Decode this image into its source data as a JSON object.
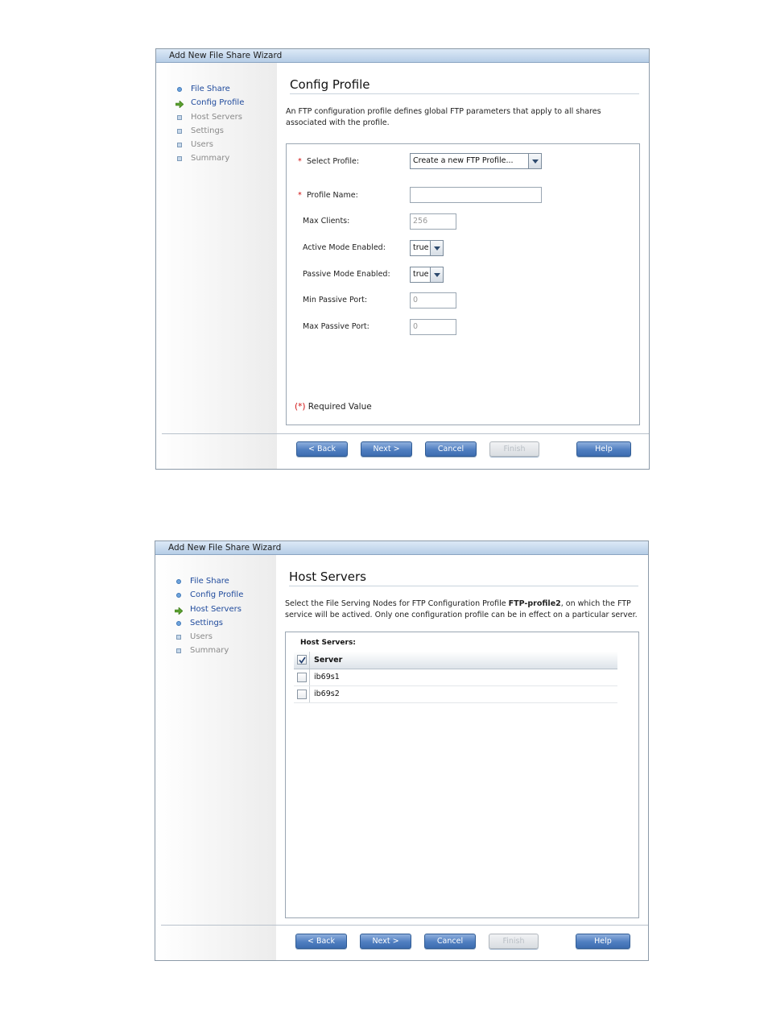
{
  "wizard1": {
    "title": "Add New File Share Wizard",
    "nav": [
      {
        "label": "File Share",
        "state": "done",
        "icon": "dot-icon"
      },
      {
        "label": "Config Profile",
        "state": "current",
        "icon": "arrow-icon"
      },
      {
        "label": "Host Servers",
        "state": "todo",
        "icon": "square-icon"
      },
      {
        "label": "Settings",
        "state": "todo",
        "icon": "square-icon"
      },
      {
        "label": "Users",
        "state": "todo",
        "icon": "square-icon"
      },
      {
        "label": "Summary",
        "state": "todo",
        "icon": "square-icon"
      }
    ],
    "page_title": "Config Profile",
    "description": "An FTP configuration profile defines global FTP parameters that apply to all shares associated with the profile.",
    "form": {
      "select_profile": {
        "label": "Select Profile:",
        "value": "Create a new FTP Profile..."
      },
      "profile_name": {
        "label": "Profile Name:",
        "value": ""
      },
      "max_clients": {
        "label": "Max Clients:",
        "value": "256"
      },
      "active_mode": {
        "label": "Active Mode Enabled:",
        "value": "true"
      },
      "passive_mode": {
        "label": "Passive Mode Enabled:",
        "value": "true"
      },
      "min_passive_port": {
        "label": "Min Passive Port:",
        "value": "0"
      },
      "max_passive_port": {
        "label": "Max Passive Port:",
        "value": "0"
      }
    },
    "required_marker": "(*)",
    "required_text": "Required Value",
    "buttons": {
      "back": "< Back",
      "next": "Next >",
      "cancel": "Cancel",
      "finish": "Finish",
      "help": "Help"
    }
  },
  "wizard2": {
    "title": "Add New File Share Wizard",
    "nav": [
      {
        "label": "File Share",
        "state": "done",
        "icon": "dot-icon"
      },
      {
        "label": "Config Profile",
        "state": "done",
        "icon": "dot-icon"
      },
      {
        "label": "Host Servers",
        "state": "current",
        "icon": "arrow-icon"
      },
      {
        "label": "Settings",
        "state": "done",
        "icon": "dot-icon"
      },
      {
        "label": "Users",
        "state": "todo",
        "icon": "square-icon"
      },
      {
        "label": "Summary",
        "state": "todo",
        "icon": "square-icon"
      }
    ],
    "page_title": "Host Servers",
    "description_pre": "Select the File Serving Nodes for FTP Configuration Profile ",
    "description_profile": "FTP-profile2",
    "description_post": ", on which the FTP service will be actived. Only one configuration profile can be in effect on a particular server.",
    "host_servers_label": "Host Servers:",
    "table": {
      "header": "Server",
      "header_checked": true,
      "rows": [
        {
          "name": "ib69s1",
          "checked": false
        },
        {
          "name": "ib69s2",
          "checked": false
        }
      ]
    },
    "buttons": {
      "back": "< Back",
      "next": "Next >",
      "cancel": "Cancel",
      "finish": "Finish",
      "help": "Help"
    }
  }
}
